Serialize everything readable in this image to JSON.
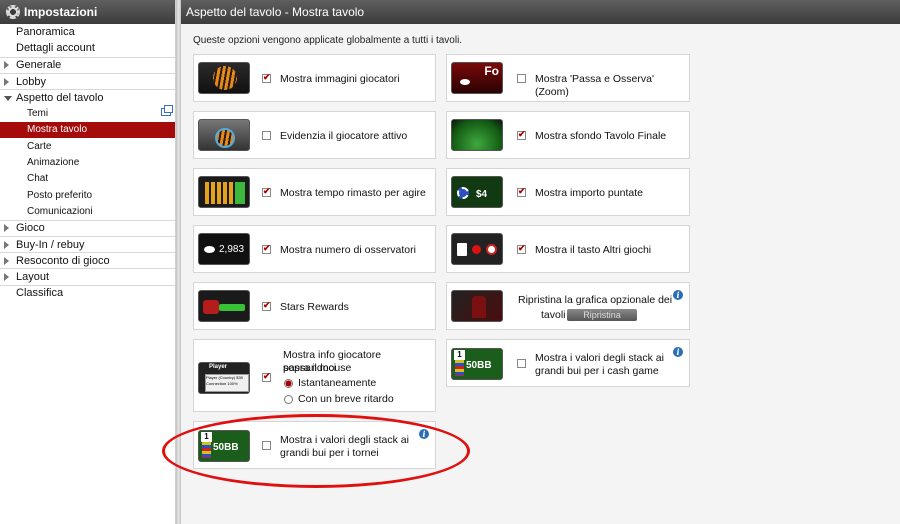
{
  "sidebar": {
    "title": "Impostazioni",
    "items": [
      {
        "label": "Panoramica",
        "level": "top",
        "expand": "none"
      },
      {
        "label": "Dettagli account",
        "level": "top",
        "expand": "none"
      },
      {
        "label": "Generale",
        "level": "top",
        "expand": "collapsed"
      },
      {
        "label": "Lobby",
        "level": "top",
        "expand": "collapsed"
      },
      {
        "label": "Aspetto del tavolo",
        "level": "top",
        "expand": "expanded"
      },
      {
        "label": "Temi",
        "level": "sub",
        "expand": "none",
        "popout": true
      },
      {
        "label": "Mostra tavolo",
        "level": "sub",
        "expand": "none",
        "active": true
      },
      {
        "label": "Carte",
        "level": "sub",
        "expand": "none"
      },
      {
        "label": "Animazione",
        "level": "sub",
        "expand": "none"
      },
      {
        "label": "Chat",
        "level": "sub",
        "expand": "none"
      },
      {
        "label": "Posto preferito",
        "level": "sub",
        "expand": "none"
      },
      {
        "label": "Comunicazioni",
        "level": "sub",
        "expand": "none"
      },
      {
        "label": "Gioco",
        "level": "top",
        "expand": "collapsed"
      },
      {
        "label": "Buy-In / rebuy",
        "level": "top",
        "expand": "collapsed"
      },
      {
        "label": "Resoconto di gioco",
        "level": "top",
        "expand": "collapsed"
      },
      {
        "label": "Layout",
        "level": "top",
        "expand": "collapsed"
      },
      {
        "label": "Classifica",
        "level": "top",
        "expand": "none"
      }
    ]
  },
  "main": {
    "title": "Aspetto del tavolo - Mostra tavolo",
    "intro": "Queste opzioni vengono applicate globalmente a tutti i tavoli.",
    "options": {
      "mostra_immagini": {
        "label": "Mostra immagini giocatori",
        "checked": true
      },
      "passa_osserva": {
        "label": "Mostra 'Passa e Osserva' (Zoom)",
        "checked": false,
        "thumb_text": "Fo"
      },
      "evidenzia": {
        "label": "Evidenzia il giocatore attivo",
        "checked": false
      },
      "sfondo_finale": {
        "label": "Mostra sfondo Tavolo Finale",
        "checked": true
      },
      "tempo_rimasto": {
        "label": "Mostra tempo rimasto per agire",
        "checked": true
      },
      "importo_puntate": {
        "label": "Mostra importo puntate",
        "checked": true,
        "thumb_text": "$4"
      },
      "osservatori": {
        "label": "Mostra numero di osservatori",
        "checked": true,
        "thumb_text": "2,983"
      },
      "altri_giochi": {
        "label": "Mostra il tasto Altri giochi",
        "checked": true
      },
      "stars_rewards": {
        "label": "Stars Rewards",
        "checked": true
      },
      "ripristina": {
        "label_line1": "Ripristina la grafica opzionale dei",
        "label_line2": "tavoli",
        "button": "Ripristina"
      },
      "info_giocatore": {
        "label_line1": "Mostra info giocatore passandoci",
        "label_line2": "sopra il mouse",
        "checked": true,
        "thumb_title": "Player",
        "thumb_line1": "Player (Country) $39",
        "thumb_line2": "Connection 100%",
        "radio1": "Istantaneamente",
        "radio2": "Con un breve ritardo",
        "selected": "radio1"
      },
      "stack_cash": {
        "label_line1": "Mostra i valori degli stack ai",
        "label_line2": "grandi bui per i cash game",
        "checked": false,
        "thumb_text": "50BB",
        "chip": "1"
      },
      "stack_tornei": {
        "label_line1": "Mostra i valori degli stack ai",
        "label_line2": "grandi bui per i tornei",
        "checked": false,
        "thumb_text": "50BB",
        "chip": "1"
      }
    }
  },
  "colors": {
    "active_nav": "#a50b0b",
    "header": "#4a4a4a",
    "highlight_ellipse": "#e01010",
    "info": "#2a6fb6"
  }
}
